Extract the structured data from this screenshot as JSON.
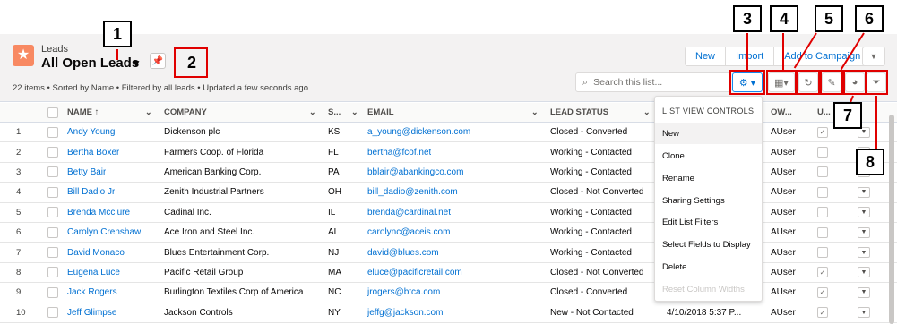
{
  "header": {
    "object_label": "Leads",
    "view_title": "All Open Leads",
    "meta": "22 items • Sorted by Name • Filtered by all leads • Updated a few seconds ago"
  },
  "actions": {
    "new_label": "New",
    "import_label": "Import",
    "campaign_label": "Add to Campaign"
  },
  "search": {
    "placeholder": "Search this list..."
  },
  "columns": [
    "NAME",
    "COMPANY",
    "S...",
    "EMAIL",
    "LEAD STATUS",
    "OW...",
    "U..."
  ],
  "rows": [
    {
      "num": "1",
      "name": "Andy Young",
      "company": "Dickenson plc",
      "state": "KS",
      "email": "a_young@dickenson.com",
      "status": "Closed - Converted",
      "owner": "AUser",
      "checked": true
    },
    {
      "num": "2",
      "name": "Bertha Boxer",
      "company": "Farmers Coop. of Florida",
      "state": "FL",
      "email": "bertha@fcof.net",
      "status": "Working - Contacted",
      "owner": "AUser",
      "checked": false
    },
    {
      "num": "3",
      "name": "Betty Bair",
      "company": "American Banking Corp.",
      "state": "PA",
      "email": "bblair@abankingco.com",
      "status": "Working - Contacted",
      "owner": "AUser",
      "checked": false
    },
    {
      "num": "4",
      "name": "Bill Dadio Jr",
      "company": "Zenith Industrial Partners",
      "state": "OH",
      "email": "bill_dadio@zenith.com",
      "status": "Closed - Not Converted",
      "owner": "AUser",
      "checked": false
    },
    {
      "num": "5",
      "name": "Brenda Mcclure",
      "company": "Cadinal Inc.",
      "state": "IL",
      "email": "brenda@cardinal.net",
      "status": "Working - Contacted",
      "owner": "AUser",
      "checked": false
    },
    {
      "num": "6",
      "name": "Carolyn Crenshaw",
      "company": "Ace Iron and Steel Inc.",
      "state": "AL",
      "email": "carolync@aceis.com",
      "status": "Working - Contacted",
      "owner": "AUser",
      "checked": false
    },
    {
      "num": "7",
      "name": "David Monaco",
      "company": "Blues Entertainment Corp.",
      "state": "NJ",
      "email": "david@blues.com",
      "status": "Working - Contacted",
      "owner": "AUser",
      "checked": false
    },
    {
      "num": "8",
      "name": "Eugena Luce",
      "company": "Pacific Retail Group",
      "state": "MA",
      "email": "eluce@pacificretail.com",
      "status": "Closed - Not Converted",
      "owner": "AUser",
      "checked": true
    },
    {
      "num": "9",
      "name": "Jack Rogers",
      "company": "Burlington Textiles Corp of America",
      "state": "NC",
      "email": "jrogers@btca.com",
      "status": "Closed - Converted",
      "owner": "AUser",
      "checked": true
    },
    {
      "num": "10",
      "name": "Jeff Glimpse",
      "company": "Jackson Controls",
      "state": "NY",
      "email": "jeffg@jackson.com",
      "status": "New - Not Contacted",
      "date": "4/10/2018 5:37 P...",
      "owner": "AUser",
      "checked": true
    }
  ],
  "menu": {
    "heading": "LIST VIEW CONTROLS",
    "items": [
      "New",
      "Clone",
      "Rename",
      "Sharing Settings",
      "Edit List Filters",
      "Select Fields to Display",
      "Delete",
      "Reset Column Widths"
    ]
  },
  "callouts": [
    "1",
    "2",
    "3",
    "4",
    "5",
    "6",
    "7",
    "8"
  ],
  "icons": [
    "lead-icon",
    "pin-icon",
    "chevron-down-icon",
    "search-icon",
    "gear-icon",
    "table-icon",
    "refresh-icon",
    "pencil-icon",
    "pie-chart-icon",
    "filter-icon",
    "sort-arrow-icon",
    "checkmark-icon"
  ],
  "colors": {
    "link": "#0070d2",
    "lead_icon": "#f88962",
    "callout_border": "#e00000"
  }
}
